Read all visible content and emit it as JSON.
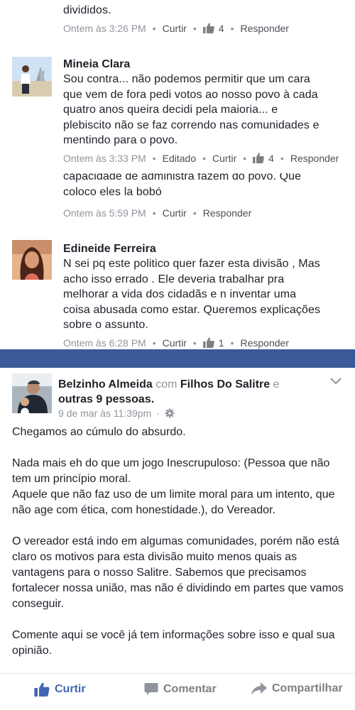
{
  "comments": [
    {
      "text_lines": [
        "divididos."
      ],
      "time": "Ontem às 3:26 PM",
      "like": "Curtir",
      "likes": "4",
      "reply": "Responder"
    },
    {
      "name": "Mineia Clara",
      "text_lines": [
        "Sou contra... não podemos permitir que um cara",
        "que vem de fora pedi votos ao nosso povo à cada",
        "quatro anos queira decidi  pela maioria... e",
        "plebiscito não se faz correndo nas comunidades e",
        "mentindo para o povo."
      ],
      "time": "Ontem às 3:33 PM",
      "edited": "Editado",
      "like": "Curtir",
      "likes": "4",
      "reply": "Responder"
    },
    {
      "text_lines": [
        "capacidade  de administra  fazem do povo. Que",
        "coloco  eles la bobó"
      ],
      "time": "Ontem às 5:59 PM",
      "like": "Curtir",
      "reply": "Responder"
    },
    {
      "name": "Edineide Ferreira",
      "text_lines": [
        "N sei pq este politico quer fazer esta divisão , Mas",
        "acho isso errado . Ele deveria trabalhar pra",
        "melhorar a vida dos cidadãs e n inventar uma",
        "coisa abusada como estar. Queremos explicações",
        "sobre o assunto."
      ],
      "time": "Ontem às 6:28 PM",
      "like": "Curtir",
      "likes": "1",
      "reply": "Responder"
    }
  ],
  "post": {
    "author": "Belzinho Almeida",
    "with_word": "com",
    "page": "Filhos Do Salitre",
    "and_word": "e",
    "others": "outras 9 pessoas",
    "period": ".",
    "time": "9 de mar às 11:39pm",
    "sep": "·",
    "paragraphs": [
      "Chegamos ao cúmulo do absurdo.",
      "Nada mais eh do que um jogo Inescrupuloso: (Pessoa que não tem um princípio moral.\nAquele que não faz uso de um limite moral para um intento, que não age com ética, com honestidade.), do Vereador.",
      "O vereador está indo em algumas comunidades, porém não está claro os motivos para esta divisão muito menos quais as vantagens para o nosso Salitre. Sabemos que precisamos fortalecer nossa união, mas não é dividindo em partes que vamos conseguir.",
      "Comente aqui se você já tem informações sobre isso e qual sua opinião."
    ],
    "actions": {
      "like": "Curtir",
      "comment": "Comentar",
      "share": "Compartilhar"
    }
  },
  "colors": {
    "blue": "#3b5998",
    "like_blue": "#4267b2",
    "meta_gray": "#90949c"
  },
  "icons": [
    "thumbs-up-icon",
    "gear-icon",
    "chevron-down-icon",
    "comment-icon",
    "share-icon"
  ]
}
